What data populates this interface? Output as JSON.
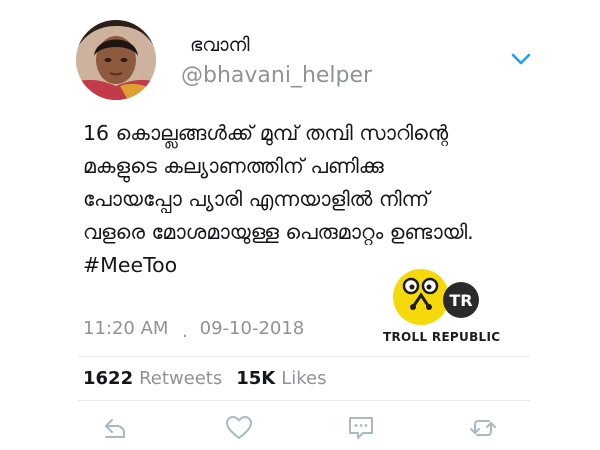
{
  "tweet": {
    "display_name": "ഭവാനി",
    "handle": "@bhavani_helper",
    "text_lines": [
      "16 കൊല്ലങ്ങൾക്ക് മുമ്പ് തമ്പി സാറിന്റെ",
      "മകളുടെ കല്യാണത്തിന് പണിക്കു",
      "പോയപ്പോ പ്യാരി എന്നയാളിൽ നിന്ന്",
      "വളരെ മോശമായുള്ള പെരുമാറ്റം ഉണ്ടായി."
    ],
    "hashtag": "#MeeToo",
    "time": "11:20 AM",
    "separator": ".",
    "date": "09-10-2018"
  },
  "stats": {
    "retweets_count": "1622",
    "retweets_label": "Retweets",
    "likes_count": "15K",
    "likes_label": "Likes"
  },
  "watermark": {
    "caption": "TROLL REPUBLIC",
    "badge": "TR"
  },
  "icons": {
    "menu": "chevron-down-icon",
    "reply": "reply-icon",
    "like": "heart-icon",
    "dm": "message-icon",
    "retweet": "retweet-icon"
  },
  "colors": {
    "text": "#14171a",
    "secondary": "#8e9399",
    "accent": "#1da1f2",
    "icon": "#aab8c2",
    "logo_yellow": "#f5d90a"
  }
}
